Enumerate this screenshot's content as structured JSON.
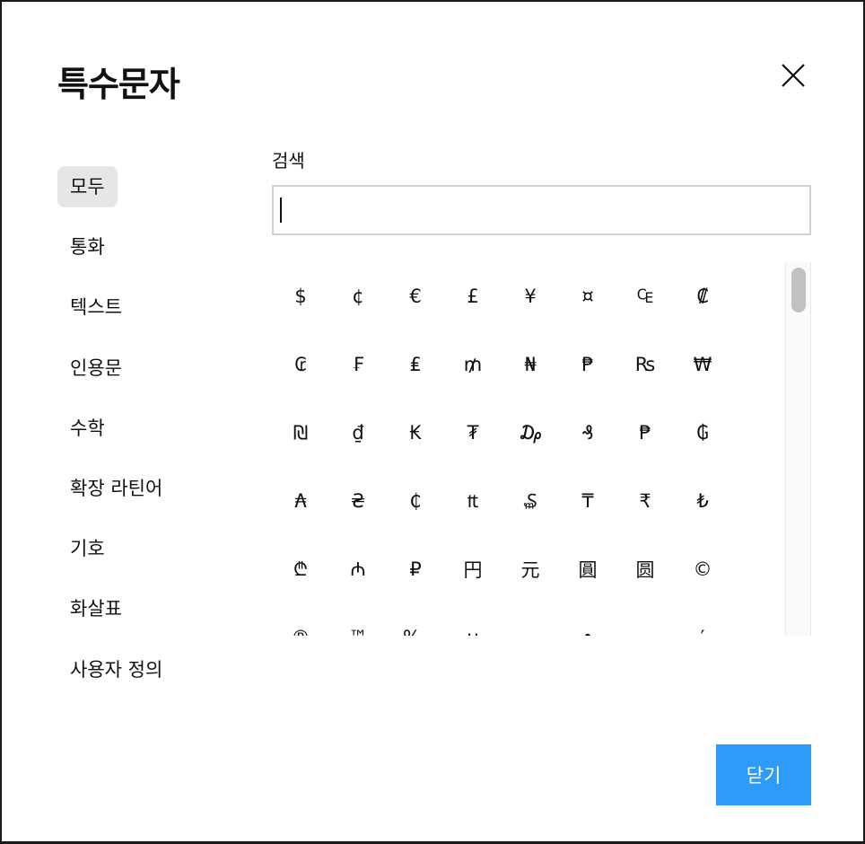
{
  "dialog": {
    "title": "특수문자",
    "close_icon": "close-icon"
  },
  "sidebar": {
    "items": [
      {
        "label": "모두",
        "active": true
      },
      {
        "label": "통화",
        "active": false
      },
      {
        "label": "텍스트",
        "active": false
      },
      {
        "label": "인용문",
        "active": false
      },
      {
        "label": "수학",
        "active": false
      },
      {
        "label": "확장 라틴어",
        "active": false
      },
      {
        "label": "기호",
        "active": false
      },
      {
        "label": "화살표",
        "active": false
      },
      {
        "label": "사용자 정의",
        "active": false
      }
    ]
  },
  "search": {
    "label": "검색",
    "value": "",
    "placeholder": ""
  },
  "symbols": [
    "$",
    "¢",
    "€",
    "£",
    "¥",
    "¤",
    "₠",
    "₡",
    "₢",
    "₣",
    "₤",
    "₥",
    "₦",
    "₱",
    "₨",
    "₩",
    "₪",
    "₫",
    "₭",
    "₮",
    "₯",
    "₰",
    "₱",
    "₲",
    "₳",
    "₴",
    "₵",
    "₶",
    "₷",
    "₸",
    "₹",
    "₺",
    "₾",
    "₼",
    "₽",
    "円",
    "元",
    "圓",
    "圆",
    "©",
    "®",
    "™",
    "‰",
    "µ",
    "·",
    "•",
    "…",
    "′"
  ],
  "footer": {
    "close_label": "닫기"
  },
  "colors": {
    "accent": "#2f9bf9",
    "active_bg": "#e6e6e6",
    "input_border": "#d0d0d0"
  }
}
